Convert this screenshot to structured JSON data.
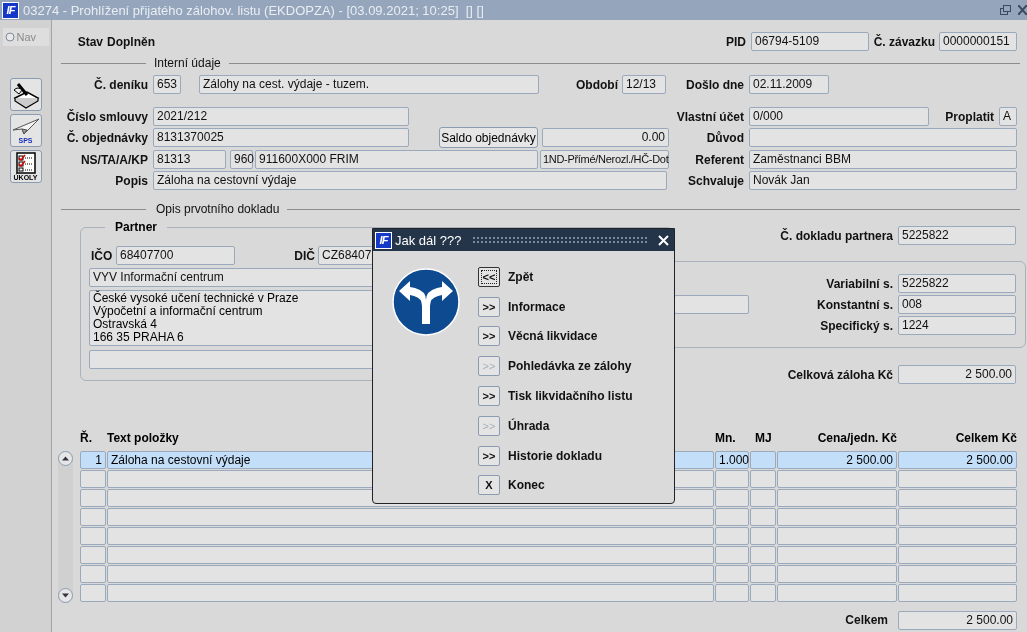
{
  "window": {
    "logo": "IF",
    "title": "03274 - Prohlížení přijatého zálohov. listu (EKDOPZA) - [03.09.2021; 10:25]  [] []"
  },
  "sidebar": {
    "nav": {
      "label": "Nav",
      "selected": false
    },
    "tools": [
      {
        "kind": "notebook"
      },
      {
        "kind": "plane",
        "label": "SPS"
      },
      {
        "kind": "tasks",
        "label": "ÚKOLY"
      }
    ]
  },
  "header": {
    "status_label": "Stav",
    "status": "Doplněn",
    "pid": {
      "label": "PID",
      "value": "06794-5109"
    },
    "liability": {
      "label": "Č. závazku",
      "value": "0000000151"
    }
  },
  "internal": {
    "title": "Interní údaje",
    "journal": {
      "label": "Č. deníku",
      "value": "653",
      "text": "Zálohy na cest. výdaje - tuzem."
    },
    "period": {
      "label": "Období",
      "value": "12/13"
    },
    "received": {
      "label": "Došlo dne",
      "value": "02.11.2009"
    },
    "contract": {
      "label": "Číslo smlouvy",
      "value": "2021/212"
    },
    "own_account": {
      "label": "Vlastní účet",
      "value": "0/000"
    },
    "pay": {
      "label": "Proplatit",
      "value": "A"
    },
    "order": {
      "label": "Č. objednávky",
      "value": "8131370025"
    },
    "order_balance": {
      "button": "Saldo objednávky",
      "value": "0.00"
    },
    "reason": {
      "label": "Důvod"
    },
    "cost_codes": {
      "label": "NS/TA/A/KP",
      "values": [
        "81313",
        "960",
        "911600X000 FRIM",
        "1ND-Přímé/Nerozl./HČ-Dot"
      ]
    },
    "referent": {
      "label": "Referent",
      "value": "Zaměstnanci BBM"
    },
    "description": {
      "label": "Popis",
      "value": "Záloha na cestovní výdaje"
    },
    "approver": {
      "label": "Schvaluje",
      "value": "Novák Jan"
    }
  },
  "document": {
    "title": "Opis prvotního dokladu",
    "partner": {
      "title": "Partner",
      "ico": {
        "label": "IČO",
        "value": "68407700"
      },
      "dic": {
        "label": "DIČ",
        "value": "CZ68407"
      },
      "name": "VYV Informační centrum",
      "address": [
        "České vysoké učení technické v Praze",
        "Výpočetní a informační centrum",
        "Ostravská 4",
        "166 35 PRAHA 6"
      ]
    },
    "partner_doc": {
      "label": "Č. dokladu partnera",
      "value": "5225822"
    },
    "symbols": [
      {
        "label": "Variabilní s.",
        "value": "5225822"
      },
      {
        "label": "Konstantní s.",
        "value": "008"
      },
      {
        "label": "Specifický s.",
        "value": "1224"
      }
    ],
    "advance_total": {
      "label": "Celková záloha Kč",
      "value": "2 500.00"
    }
  },
  "items": {
    "columns": [
      "Ř.",
      "Text položky",
      "Mn.",
      "MJ",
      "Cena/jedn. Kč",
      "Celkem Kč"
    ],
    "rows": [
      {
        "number": "1",
        "text": "Záloha na cestovní výdaje",
        "quantity": "1.000",
        "unit_price": "2 500.00",
        "total": "2 500.00",
        "selected": true
      }
    ]
  },
  "total": {
    "label": "Celkem",
    "value": "2 500.00"
  },
  "dialog": {
    "logo": "IF",
    "title": "Jak dál ???",
    "actions": [
      {
        "key": "<<",
        "label": "Zpět",
        "disabled": false,
        "focused": true
      },
      {
        "key": ">>",
        "label": "Informace",
        "disabled": false,
        "focused": false
      },
      {
        "key": ">>",
        "label": "Věcná likvidace",
        "disabled": false,
        "focused": false
      },
      {
        "key": ">>",
        "label": "Pohledávka ze zálohy",
        "disabled": true,
        "focused": false
      },
      {
        "key": ">>",
        "label": "Tisk likvidačního listu",
        "disabled": false,
        "focused": false
      },
      {
        "key": ">>",
        "label": "Úhrada",
        "disabled": true,
        "focused": false
      },
      {
        "key": ">>",
        "label": "Historie dokladu",
        "disabled": false,
        "focused": false
      },
      {
        "key": "X",
        "label": "Konec",
        "disabled": false,
        "focused": false
      }
    ]
  }
}
